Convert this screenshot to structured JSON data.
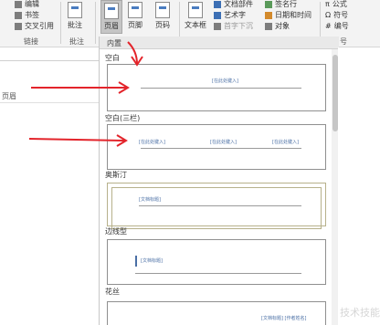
{
  "ribbon": {
    "row1": {
      "edit": "编辑",
      "bookmark": "书签",
      "xref": "交叉引用",
      "parts": "文档部件",
      "sig": "签名行",
      "formula": "公式"
    },
    "row2": {
      "art": "艺术字",
      "datetime": "日期和时间",
      "symbol": "符号"
    },
    "row3": {
      "dropcap": "首字下沉",
      "object": "对象",
      "number": "编号"
    },
    "big": {
      "comment": "批注",
      "header": "页眉",
      "footer": "页脚",
      "page_number": "页码",
      "textbox": "文本框"
    },
    "groups": {
      "links": "链接",
      "comments": "批注",
      "symbols": "号"
    }
  },
  "doc": {
    "text": "页眉"
  },
  "gallery": {
    "section": "内置",
    "items": [
      {
        "label": "空白",
        "texts": [
          "[在此处键入]"
        ]
      },
      {
        "label": "空白(三栏)",
        "texts": [
          "[在此处键入]",
          "[在此处键入]",
          "[在此处键入]"
        ]
      },
      {
        "label": "奥斯汀",
        "texts": [
          "[文档标题]"
        ]
      },
      {
        "label": "边线型",
        "texts": [
          "[文档标题]"
        ]
      },
      {
        "label": "花丝",
        "texts": [
          "[文档标题] [作者姓名]"
        ]
      }
    ]
  },
  "watermark": "技术技能"
}
